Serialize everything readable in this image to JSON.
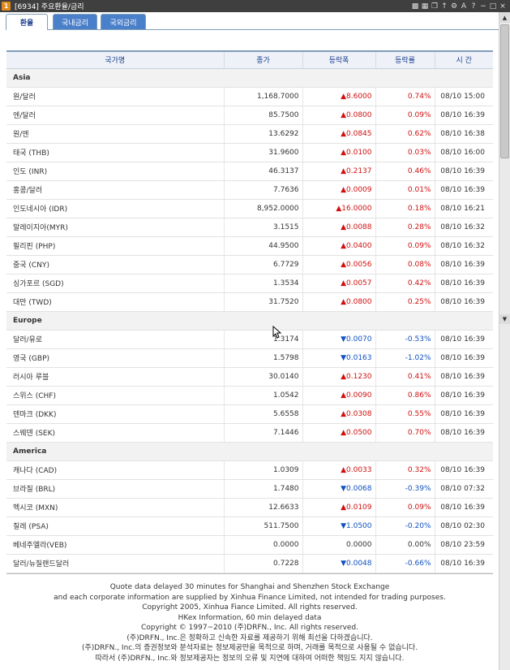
{
  "window": {
    "badge": "1",
    "title": "[6934] 주요환율/금리",
    "icons": [
      "lock-icon",
      "grid-icon",
      "window-icon",
      "pin-icon",
      "settings-icon",
      "font-icon",
      "help-icon",
      "minimize-icon",
      "maximize-icon",
      "close-icon"
    ]
  },
  "tabs": [
    {
      "label": "환율",
      "active": true
    },
    {
      "label": "국내금리",
      "active": false
    },
    {
      "label": "국외금리",
      "active": false
    }
  ],
  "table": {
    "headers": [
      "국가명",
      "종가",
      "등락폭",
      "등락률",
      "시 간"
    ],
    "regions": [
      {
        "name": "Asia",
        "rows": [
          {
            "name": "원/달러",
            "price": "1,168.7000",
            "change": "▲8.6000",
            "rate": "0.74%",
            "time": "08/10 15:00",
            "dir": "up"
          },
          {
            "name": "엔/달러",
            "price": "85.7500",
            "change": "▲0.0800",
            "rate": "0.09%",
            "time": "08/10 16:39",
            "dir": "up"
          },
          {
            "name": "원/엔",
            "price": "13.6292",
            "change": "▲0.0845",
            "rate": "0.62%",
            "time": "08/10 16:38",
            "dir": "up"
          },
          {
            "name": "태국 (THB)",
            "price": "31.9600",
            "change": "▲0.0100",
            "rate": "0.03%",
            "time": "08/10 16:00",
            "dir": "up"
          },
          {
            "name": "인도 (INR)",
            "price": "46.3137",
            "change": "▲0.2137",
            "rate": "0.46%",
            "time": "08/10 16:39",
            "dir": "up"
          },
          {
            "name": "홍콩/달러",
            "price": "7.7636",
            "change": "▲0.0009",
            "rate": "0.01%",
            "time": "08/10 16:39",
            "dir": "up"
          },
          {
            "name": "인도네시아 (IDR)",
            "price": "8,952.0000",
            "change": "▲16.0000",
            "rate": "0.18%",
            "time": "08/10 16:21",
            "dir": "up"
          },
          {
            "name": "말레이지아(MYR)",
            "price": "3.1515",
            "change": "▲0.0088",
            "rate": "0.28%",
            "time": "08/10 16:32",
            "dir": "up"
          },
          {
            "name": "필리핀 (PHP)",
            "price": "44.9500",
            "change": "▲0.0400",
            "rate": "0.09%",
            "time": "08/10 16:32",
            "dir": "up"
          },
          {
            "name": "중국 (CNY)",
            "price": "6.7729",
            "change": "▲0.0056",
            "rate": "0.08%",
            "time": "08/10 16:39",
            "dir": "up"
          },
          {
            "name": "싱가포르 (SGD)",
            "price": "1.3534",
            "change": "▲0.0057",
            "rate": "0.42%",
            "time": "08/10 16:39",
            "dir": "up"
          },
          {
            "name": "대만 (TWD)",
            "price": "31.7520",
            "change": "▲0.0800",
            "rate": "0.25%",
            "time": "08/10 16:39",
            "dir": "up"
          }
        ]
      },
      {
        "name": "Europe",
        "rows": [
          {
            "name": "달러/유로",
            "price": "1.3174",
            "change": "▼0.0070",
            "rate": "-0.53%",
            "time": "08/10 16:39",
            "dir": "down"
          },
          {
            "name": "영국 (GBP)",
            "price": "1.5798",
            "change": "▼0.0163",
            "rate": "-1.02%",
            "time": "08/10 16:39",
            "dir": "down"
          },
          {
            "name": "러시아 루블",
            "price": "30.0140",
            "change": "▲0.1230",
            "rate": "0.41%",
            "time": "08/10 16:39",
            "dir": "up"
          },
          {
            "name": "스위스 (CHF)",
            "price": "1.0542",
            "change": "▲0.0090",
            "rate": "0.86%",
            "time": "08/10 16:39",
            "dir": "up"
          },
          {
            "name": "덴마크 (DKK)",
            "price": "5.6558",
            "change": "▲0.0308",
            "rate": "0.55%",
            "time": "08/10 16:39",
            "dir": "up"
          },
          {
            "name": "스웨덴 (SEK)",
            "price": "7.1446",
            "change": "▲0.0500",
            "rate": "0.70%",
            "time": "08/10 16:39",
            "dir": "up"
          }
        ]
      },
      {
        "name": "America",
        "rows": [
          {
            "name": "캐나다 (CAD)",
            "price": "1.0309",
            "change": "▲0.0033",
            "rate": "0.32%",
            "time": "08/10 16:39",
            "dir": "up"
          },
          {
            "name": "브라질 (BRL)",
            "price": "1.7480",
            "change": "▼0.0068",
            "rate": "-0.39%",
            "time": "08/10 07:32",
            "dir": "down"
          },
          {
            "name": "멕시코 (MXN)",
            "price": "12.6633",
            "change": "▲0.0109",
            "rate": "0.09%",
            "time": "08/10 16:39",
            "dir": "up"
          },
          {
            "name": "칠레 (PSA)",
            "price": "511.7500",
            "change": "▼1.0500",
            "rate": "-0.20%",
            "time": "08/10 02:30",
            "dir": "down"
          },
          {
            "name": "베네주엘라(VEB)",
            "price": "0.0000",
            "change": "0.0000",
            "rate": "0.00%",
            "time": "08/10 23:59",
            "dir": "flat"
          },
          {
            "name": "달러/뉴질랜드달러",
            "price": "0.7228",
            "change": "▼0.0048",
            "rate": "-0.66%",
            "time": "08/10 16:39",
            "dir": "down"
          }
        ]
      }
    ]
  },
  "footer": [
    "Quote data delayed 30 minutes for Shanghai and Shenzhen Stock Exchange",
    "and each corporate information are supplied by Xinhua Finance Limited, not intended for trading purposes.",
    "Copyright 2005, Xinhua Fiance Limited. All rights reserved.",
    "HKex Information, 60 min delayed data",
    "Copyright © 1997~2010 (주)DRFN., Inc. All rights reserved.",
    "(주)DRFN., Inc.은 정확하고 신속한 자료를 제공하기 위해 최선을 다하겠습니다.",
    "(주)DRFN., Inc.의 증권정보와 분석자료는 정보제공만을 목적으로 하며, 거래를 목적으로 사용될 수 없습니다.",
    "따라서 (주)DRFN., Inc.와 정보제공자는 정보의 오류 및 지연에 대하여 어떠한 책임도 지지 않습니다."
  ],
  "colors": {
    "up": "#d01010",
    "down": "#1050c0",
    "tab_active_text": "#1d3f8f",
    "tab_inactive_bg": "#4a7fc9",
    "titlebar": "#3f3f3f"
  }
}
